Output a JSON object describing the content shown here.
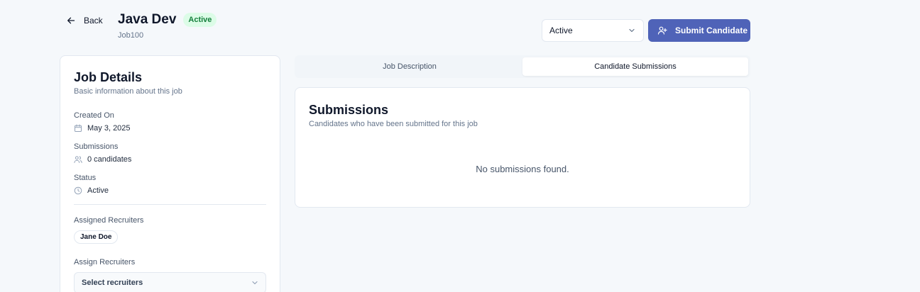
{
  "header": {
    "back_label": "Back",
    "title": "Java Dev",
    "status_badge": "Active",
    "job_id": "Job100",
    "status_select_value": "Active",
    "submit_label": "Submit Candidate"
  },
  "job_details": {
    "title": "Job Details",
    "subtitle": "Basic information about this job",
    "fields": [
      {
        "label": "Created On",
        "value": "May 3, 2025",
        "icon": "calendar-icon"
      },
      {
        "label": "Submissions",
        "value": "0 candidates",
        "icon": "users-icon"
      },
      {
        "label": "Status",
        "value": "Active",
        "icon": "clock-icon"
      }
    ],
    "assigned_label": "Assigned Recruiters",
    "assigned_recruiters": [
      "Jane Doe"
    ],
    "assign_label": "Assign Recruiters",
    "assign_placeholder": "Select recruiters"
  },
  "tabs": [
    {
      "label": "Job Description",
      "active": false
    },
    {
      "label": "Candidate Submissions",
      "active": true
    }
  ],
  "submissions": {
    "title": "Submissions",
    "subtitle": "Candidates who have been submitted for this job",
    "empty_text": "No submissions found."
  },
  "colors": {
    "primary": "#4f63b8",
    "badge_bg": "#dcfce7",
    "badge_text": "#15803d",
    "background": "#f5f8fb"
  }
}
